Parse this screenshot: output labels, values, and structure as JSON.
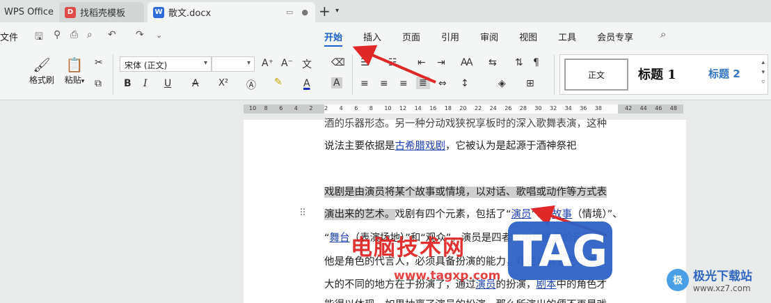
{
  "tabs": {
    "wps": "WPS Office",
    "template": "找稻壳模板",
    "template_badge": "D",
    "doc": "散文.docx",
    "doc_badge": "W",
    "new_tab": "+",
    "new_tab_arrow": "▾",
    "window_icon": "▭",
    "dot_icon": "●"
  },
  "menu": {
    "file": "文件",
    "tabs": [
      {
        "label": "开始",
        "active": true
      },
      {
        "label": "插入"
      },
      {
        "label": "页面"
      },
      {
        "label": "引用"
      },
      {
        "label": "审阅"
      },
      {
        "label": "视图"
      },
      {
        "label": "工具"
      },
      {
        "label": "会员专享"
      }
    ],
    "search_icon": "⌕"
  },
  "ribbon": {
    "format_painter": "格式刷",
    "paste": "粘贴",
    "font_name": "宋体 (正文)",
    "font_size": "",
    "styles": {
      "normal": "正文",
      "h1": "标题 1",
      "h2": "标题 2"
    },
    "icons": {
      "bold": "B",
      "italic": "I",
      "underline": "U",
      "strike": "A",
      "superscript": "X²",
      "grow": "A⁺",
      "shrink": "A⁻",
      "pinyin": "文",
      "eraser": "⌫",
      "font_color": "A",
      "char_shade": "A"
    }
  },
  "ruler": {
    "ticks": [
      "10",
      "8",
      "6",
      "4",
      "2",
      "2",
      "4",
      "6",
      "8",
      "10",
      "12",
      "14",
      "16",
      "18",
      "20",
      "22",
      "24",
      "26",
      "28",
      "30",
      "32",
      "34",
      "36",
      "38",
      "42",
      "44",
      "46",
      "48"
    ]
  },
  "document": {
    "line0": "酒的乐器形态。另一种分动戏狭祝享板时的深入歌舞表演，这种",
    "line1_pre": "说法主要依据是",
    "line1_link": "古希腊戏剧",
    "line1_post": "，它被认为是起源于酒神祭祀",
    "line2": "戏剧是由演员将某个故事或情境，以对话、歌唱或动作等方式表",
    "line3_hl": "演出来的艺术。",
    "line3_a": "戏剧有四个元素，包括了“",
    "line3_link1": "演员",
    "line3_b": "”、“",
    "line3_link2": "故事",
    "line3_c": "（情境）”、",
    "line4_pre": "“",
    "line4_link": "舞台",
    "line4_post": "（表演场地）”和“观众”。演员是四者当中最重要的元素，",
    "line5": "他是角色的代言人，必须具备扮演的能力，戏剧与其它艺术类最",
    "line6_pre": "大的不同的地方在于扮演了，通过",
    "line6_link1": "演员",
    "line6_mid": "的扮演，",
    "line6_link2": "剧本",
    "line6_post": "中的角色才",
    "line7": "能得以体现，如果抽离了演员的扮演，那么所演出的便不再是戏"
  },
  "watermark": {
    "brand": "电脑技术网",
    "url": "www.tagxp.com",
    "tag": "TAG",
    "logo_mark": "极",
    "site_cn": "极光下载站",
    "site_url": "www.xz7.com"
  }
}
